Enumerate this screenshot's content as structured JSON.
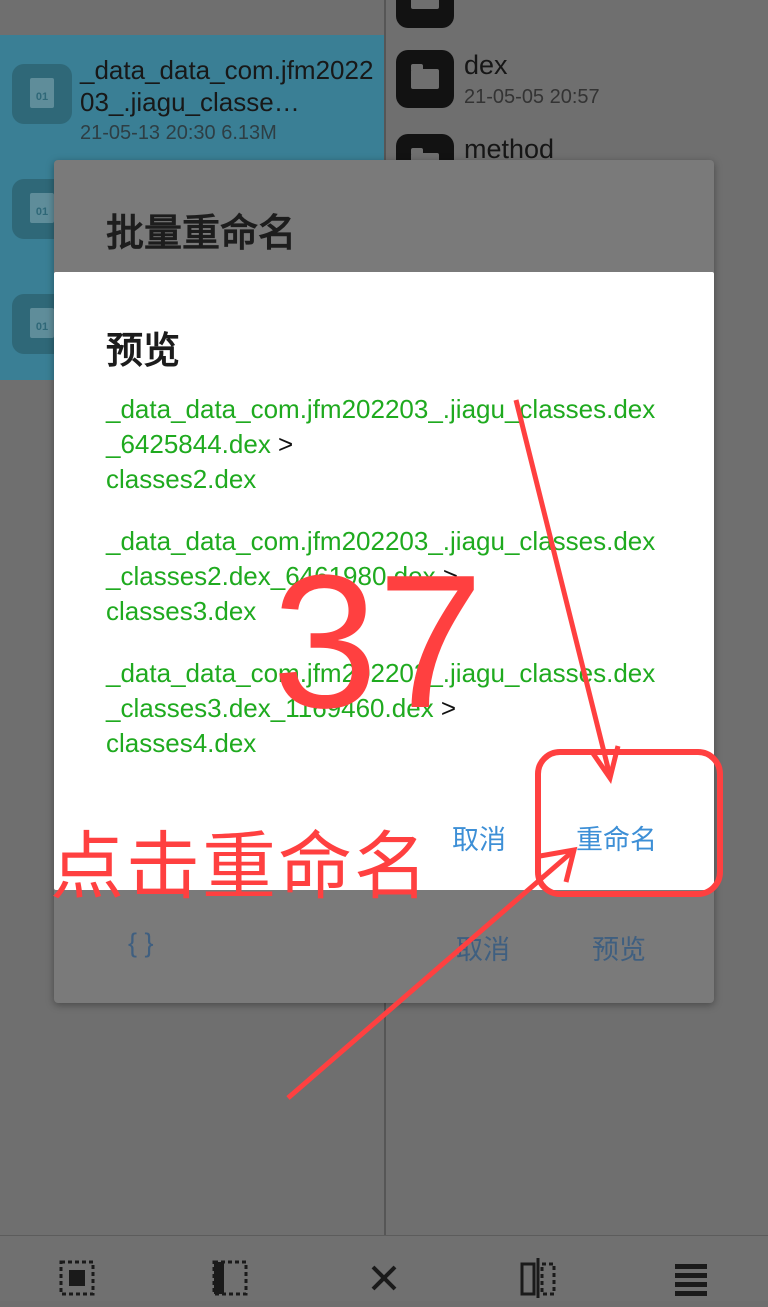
{
  "background": {
    "left_files": [
      {
        "name": "_data_data_com.jfm202203_.jiagu_classe…",
        "meta": "21-05-13 20:30  6.13M",
        "icon_label": "01"
      },
      {
        "name": "",
        "meta": "",
        "icon_label": "01"
      },
      {
        "name": "",
        "meta": "",
        "icon_label": "01"
      }
    ],
    "right_folders": [
      {
        "name": "dex",
        "meta": "21-05-05 20:57"
      },
      {
        "name": "method",
        "meta": ""
      }
    ]
  },
  "batch_dialog": {
    "title": "批量重命名",
    "braces_button": "{ }",
    "cancel_button": "取消",
    "preview_button": "预览"
  },
  "preview_dialog": {
    "title": "预览",
    "items": [
      {
        "source": "_data_data_com.jfm202203_.jiagu_classes.dex_6425844.dex",
        "arrow": " >",
        "target": "classes2.dex"
      },
      {
        "source": "_data_data_com.jfm202203_.jiagu_classes.dex_classes2.dex_6461980.dex",
        "arrow": " >",
        "target": "classes3.dex"
      },
      {
        "source": "_data_data_com.jfm202203_.jiagu_classes.dex_classes3.dex_1169460.dex",
        "arrow": " >",
        "target": "classes4.dex"
      }
    ],
    "cancel_button": "取消",
    "rename_button": "重命名"
  },
  "annotation": {
    "step_number": "37",
    "instruction": "点击重命名",
    "color": "#ff4040"
  },
  "bottom_toolbar": {
    "icons": [
      "select-all-icon",
      "select-range-icon",
      "close-icon",
      "split-view-icon",
      "list-icon"
    ]
  }
}
